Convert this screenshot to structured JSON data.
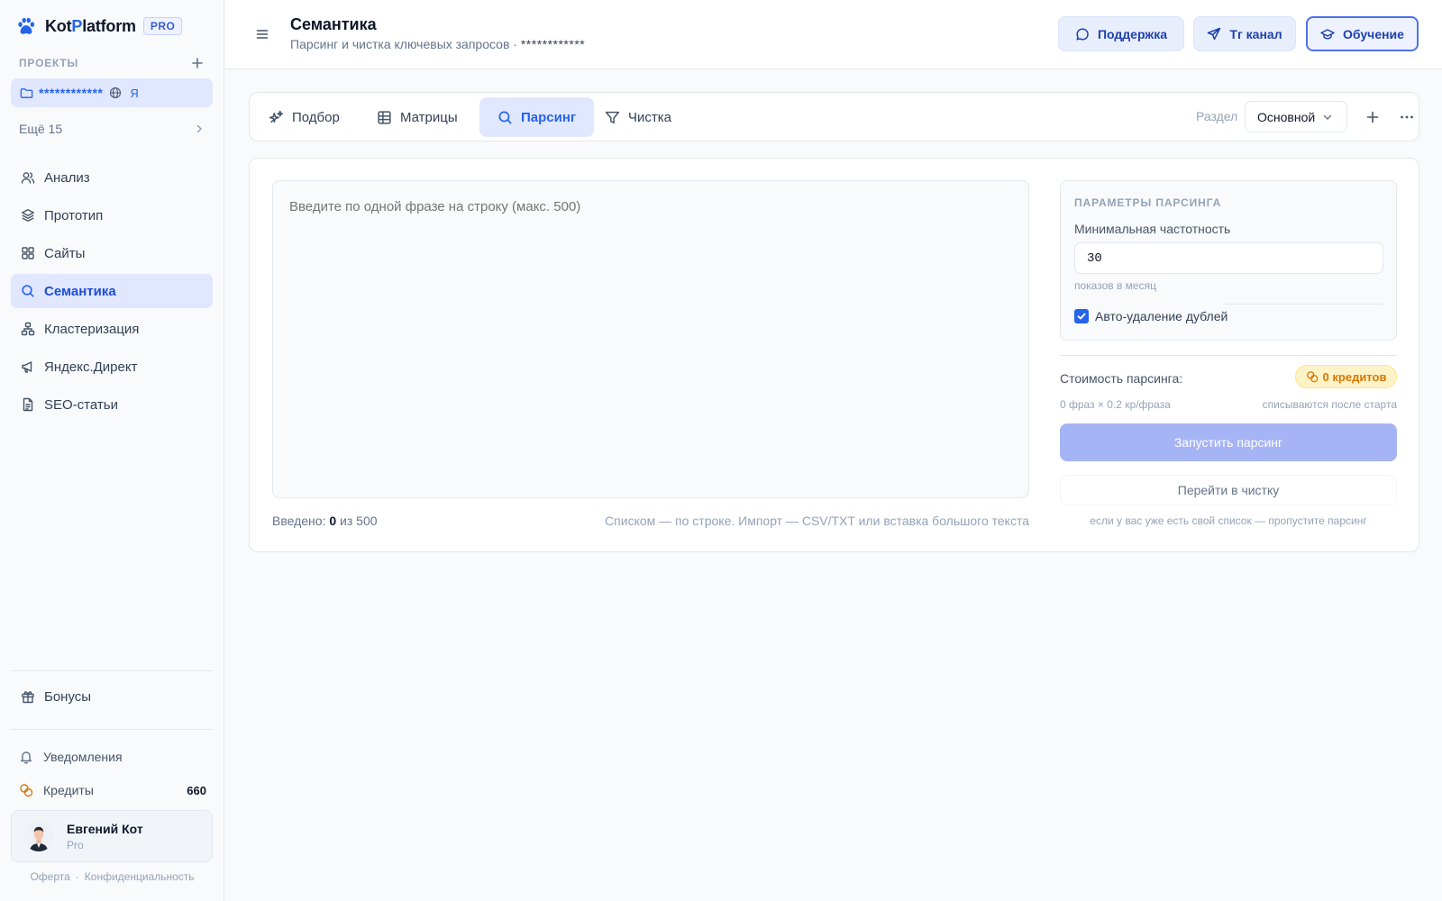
{
  "brand": {
    "name_part1": "Kot",
    "name_accent": "P",
    "name_part2": "latform",
    "badge": "PRO",
    "accent_color": "#2563eb"
  },
  "sidebar": {
    "projects_label": "ПРОЕКТЫ",
    "active_project": {
      "name": "************",
      "engine_label": "Я"
    },
    "more_label": "Ещё 15",
    "nav": [
      {
        "label": "Анализ",
        "icon": "users-icon"
      },
      {
        "label": "Прототип",
        "icon": "layers-icon"
      },
      {
        "label": "Сайты",
        "icon": "grid-icon"
      },
      {
        "label": "Семантика",
        "icon": "search-icon",
        "active": true
      },
      {
        "label": "Кластеризация",
        "icon": "cluster-icon"
      },
      {
        "label": "Яндекс.Директ",
        "icon": "megaphone-icon"
      },
      {
        "label": "SEO-статьи",
        "icon": "document-icon"
      }
    ],
    "bonus_label": "Бонусы",
    "notifications_label": "Уведомления",
    "credits_label": "Кредиты",
    "credits_value": "660",
    "user": {
      "name": "Евгений Кот",
      "plan": "Pro"
    },
    "legal": {
      "offer": "Оферта",
      "privacy": "Конфиденциальность"
    }
  },
  "header": {
    "title": "Семантика",
    "subtitle": "Парсинг и чистка ключевых запросов",
    "subtitle_sep": " · ",
    "subtitle_mask": "************",
    "buttons": {
      "support": "Поддержка",
      "telegram": "Тг канал",
      "learn": "Обучение"
    }
  },
  "tabs": {
    "items": [
      {
        "label": "Подбор",
        "icon": "sparkles-icon"
      },
      {
        "label": "Матрицы",
        "icon": "table-icon"
      },
      {
        "label": "Парсинг",
        "icon": "search-icon",
        "active": true
      },
      {
        "label": "Чистка",
        "icon": "filter-icon"
      }
    ],
    "section_label": "Раздел",
    "section_value": "Основной"
  },
  "editor": {
    "placeholder": "Введите по одной фразе на строку (макс. 500)",
    "entered_label": "Введено:",
    "entered_count": "0",
    "max_label": "из 500",
    "hint": "Списком — по строке. Импорт — CSV/TXT или вставка большого текста"
  },
  "params": {
    "title": "ПАРАМЕТРЫ ПАРСИНГА",
    "min_freq_label": "Минимальная частотность",
    "min_freq_value": "30",
    "min_freq_note": "показов в месяц",
    "dedupe_label": "Авто-удаление дублей",
    "dedupe_checked": true
  },
  "cost": {
    "label": "Стоимость парсинга:",
    "credits": "0 кредитов",
    "formula": "0 фраз × 0.2 кр/фраза",
    "note": "списываются после старта",
    "run_button": "Запустить парсинг",
    "goto_button": "Перейти в чистку",
    "skip_note": "если у вас уже есть свой список — пропустите парсинг"
  }
}
